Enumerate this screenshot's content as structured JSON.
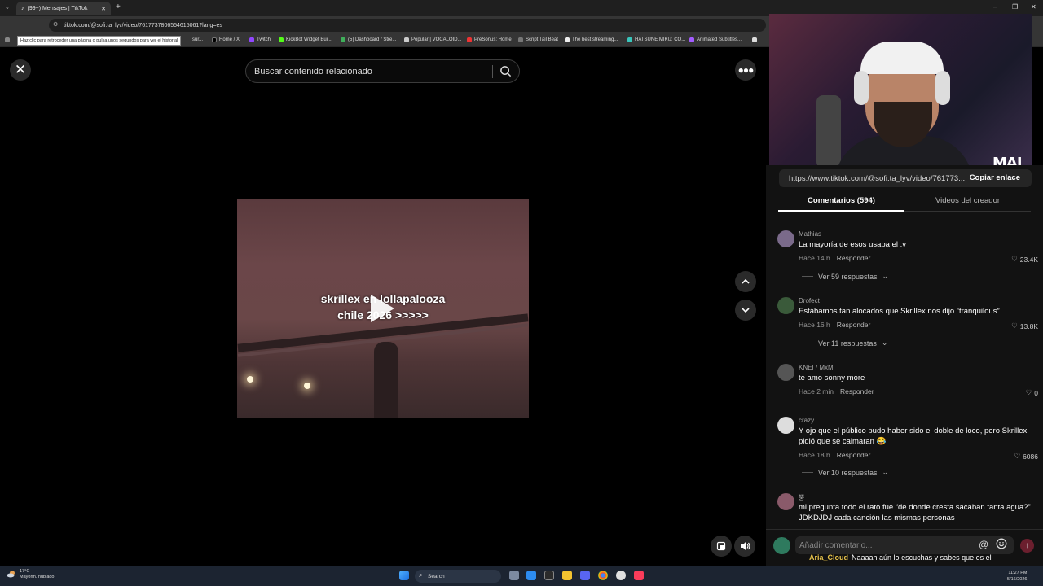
{
  "browser": {
    "tab_title": "(99+) Mensajes | TikTok",
    "url": "tiktok.com/@sofi.ta_lyv/video/7617737806554615061?lang=es",
    "back_tooltip": "Haz clic para retroceder una página o pulsa unos segundos para ver el historial",
    "bookmarks": [
      "sur...",
      "Home / X",
      "Twitch",
      "KickBot Widget Buil...",
      "(5) Dashboard / Stre...",
      "Popular | VOCALOID...",
      "PreSonus: Home",
      "Script Tail Beat",
      "The best streaming...",
      "HATSUNE MIKU: CO...",
      "Animated Subtitles..."
    ]
  },
  "player": {
    "search_placeholder": "Buscar contenido relacionado",
    "caption": "skrillex en lollapalooza\nchile 2026 >>>>>"
  },
  "webcam": {
    "logo": "MAI"
  },
  "panel": {
    "link_url": "https://www.tiktok.com/@sofi.ta_lyv/video/761773...",
    "copy_label": "Copiar enlace",
    "tab_comments": "Comentarios (594)",
    "tab_creator": "Videos del creador",
    "reply_label": "Responder",
    "comments": [
      {
        "user": "Mathias",
        "text": "La mayoría de esos usaba el :v",
        "time": "Hace 14 h",
        "likes": "23.4K",
        "replies": "Ver 59 respuestas"
      },
      {
        "user": "Drofect",
        "text": "Estábamos tan alocados que Skrillex nos dijo “tranquilous”",
        "time": "Hace 16 h",
        "likes": "13.8K",
        "replies": "Ver 11 respuestas"
      },
      {
        "user": "KNEI / MxM",
        "text": "te amo sonny more",
        "time": "Hace 2 min",
        "likes": "0",
        "replies": ""
      },
      {
        "user": "crazy",
        "text": "Y ojo que el público pudo haber sido el doble de loco, pero Skrillex pidió que se calmaran 😂",
        "time": "Hace 18 h",
        "likes": "6086",
        "replies": "Ver 10 respuestas"
      },
      {
        "user": "뿡",
        "text": "mi pregunta todo el rato fue “de donde cresta sacaban tanta agua?” JDKDJDJ cada canción las mismas personas",
        "time": "",
        "likes": "",
        "replies": ""
      }
    ],
    "comment_placeholder": "Añadir comentario...",
    "chat_user": "Aria_Cloud",
    "chat_text": "Naaaah aún lo escuchas y sabes que es el"
  },
  "taskbar": {
    "temp": "17°C",
    "weather": "Mayorm. nublado",
    "search": "Search",
    "time": "11:27 PM",
    "date": "5/16/2026"
  }
}
